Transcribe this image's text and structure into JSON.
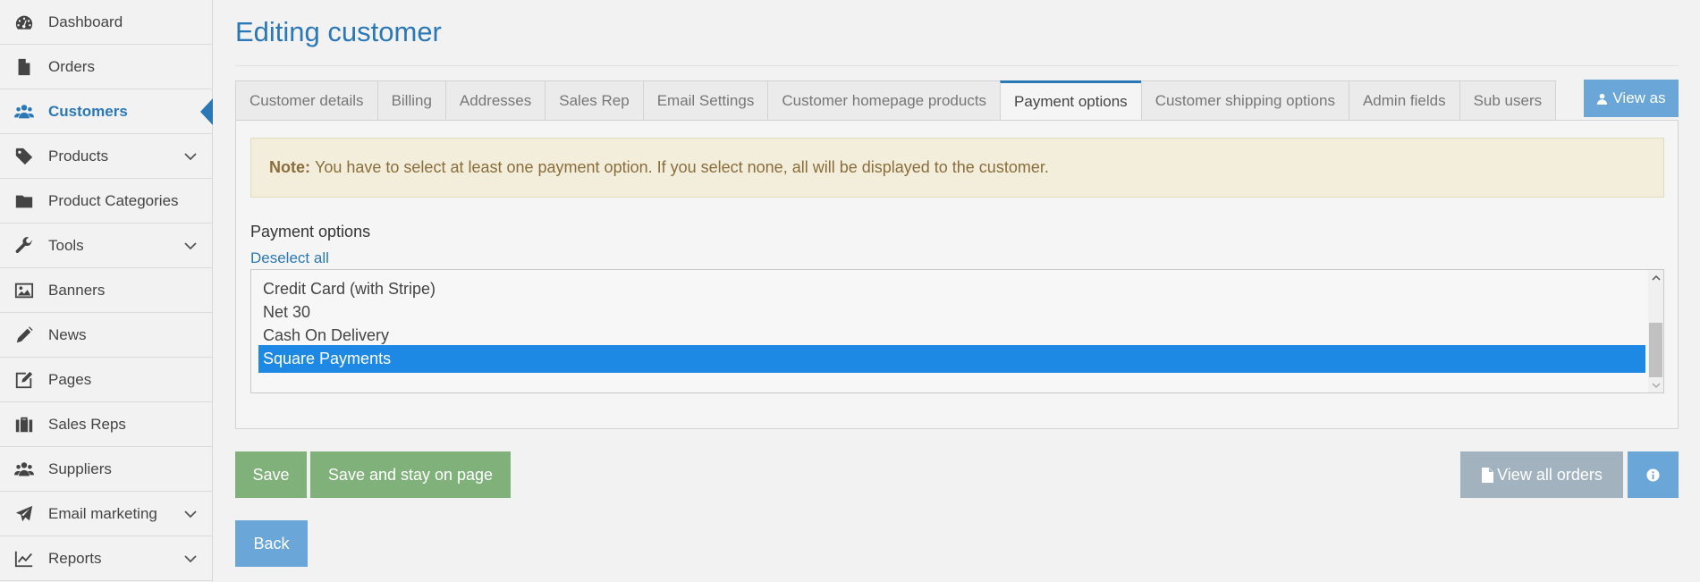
{
  "sidebar": {
    "items": [
      {
        "label": "Dashboard",
        "icon": "dashboard-icon"
      },
      {
        "label": "Orders",
        "icon": "file-icon"
      },
      {
        "label": "Customers",
        "icon": "users-icon",
        "active": true
      },
      {
        "label": "Products",
        "icon": "tag-icon",
        "chevron": true
      },
      {
        "label": "Product Categories",
        "icon": "folder-icon"
      },
      {
        "label": "Tools",
        "icon": "wrench-icon",
        "chevron": true
      },
      {
        "label": "Banners",
        "icon": "image-icon"
      },
      {
        "label": "News",
        "icon": "pencil-icon"
      },
      {
        "label": "Pages",
        "icon": "edit-icon"
      },
      {
        "label": "Sales Reps",
        "icon": "briefcase-icon"
      },
      {
        "label": "Suppliers",
        "icon": "users-icon"
      },
      {
        "label": "Email marketing",
        "icon": "paper-plane-icon",
        "chevron": true
      },
      {
        "label": "Reports",
        "icon": "line-chart-icon",
        "chevron": true
      }
    ]
  },
  "main": {
    "title": "Editing customer",
    "tabs": [
      {
        "label": "Customer details"
      },
      {
        "label": "Billing"
      },
      {
        "label": "Addresses"
      },
      {
        "label": "Sales Rep"
      },
      {
        "label": "Email Settings"
      },
      {
        "label": "Customer homepage products"
      },
      {
        "label": "Payment options",
        "active": true
      },
      {
        "label": "Customer shipping options"
      },
      {
        "label": "Admin fields"
      },
      {
        "label": "Sub users"
      }
    ],
    "view_as_label": "View as",
    "note": {
      "strong": "Note:",
      "text": "You have to select at least one payment option. If you select none, all will be displayed to the customer."
    },
    "payment_options_label": "Payment options",
    "deselect_all_label": "Deselect all",
    "payment_options": [
      {
        "label": "Credit Card (with Stripe)",
        "selected": false
      },
      {
        "label": "Net 30",
        "selected": false
      },
      {
        "label": "Cash On Delivery",
        "selected": false
      },
      {
        "label": "Square Payments",
        "selected": true
      }
    ]
  },
  "actions": {
    "save_label": "Save",
    "save_stay_label": "Save and stay on page",
    "back_label": "Back",
    "view_orders_label": "View all orders"
  },
  "colors": {
    "accent": "#2b78b6",
    "success": "#80b17b",
    "info": "#6aa7d8",
    "selected": "#1e88e5",
    "note_bg": "#f2eedb",
    "note_text": "#8a6d3b"
  }
}
